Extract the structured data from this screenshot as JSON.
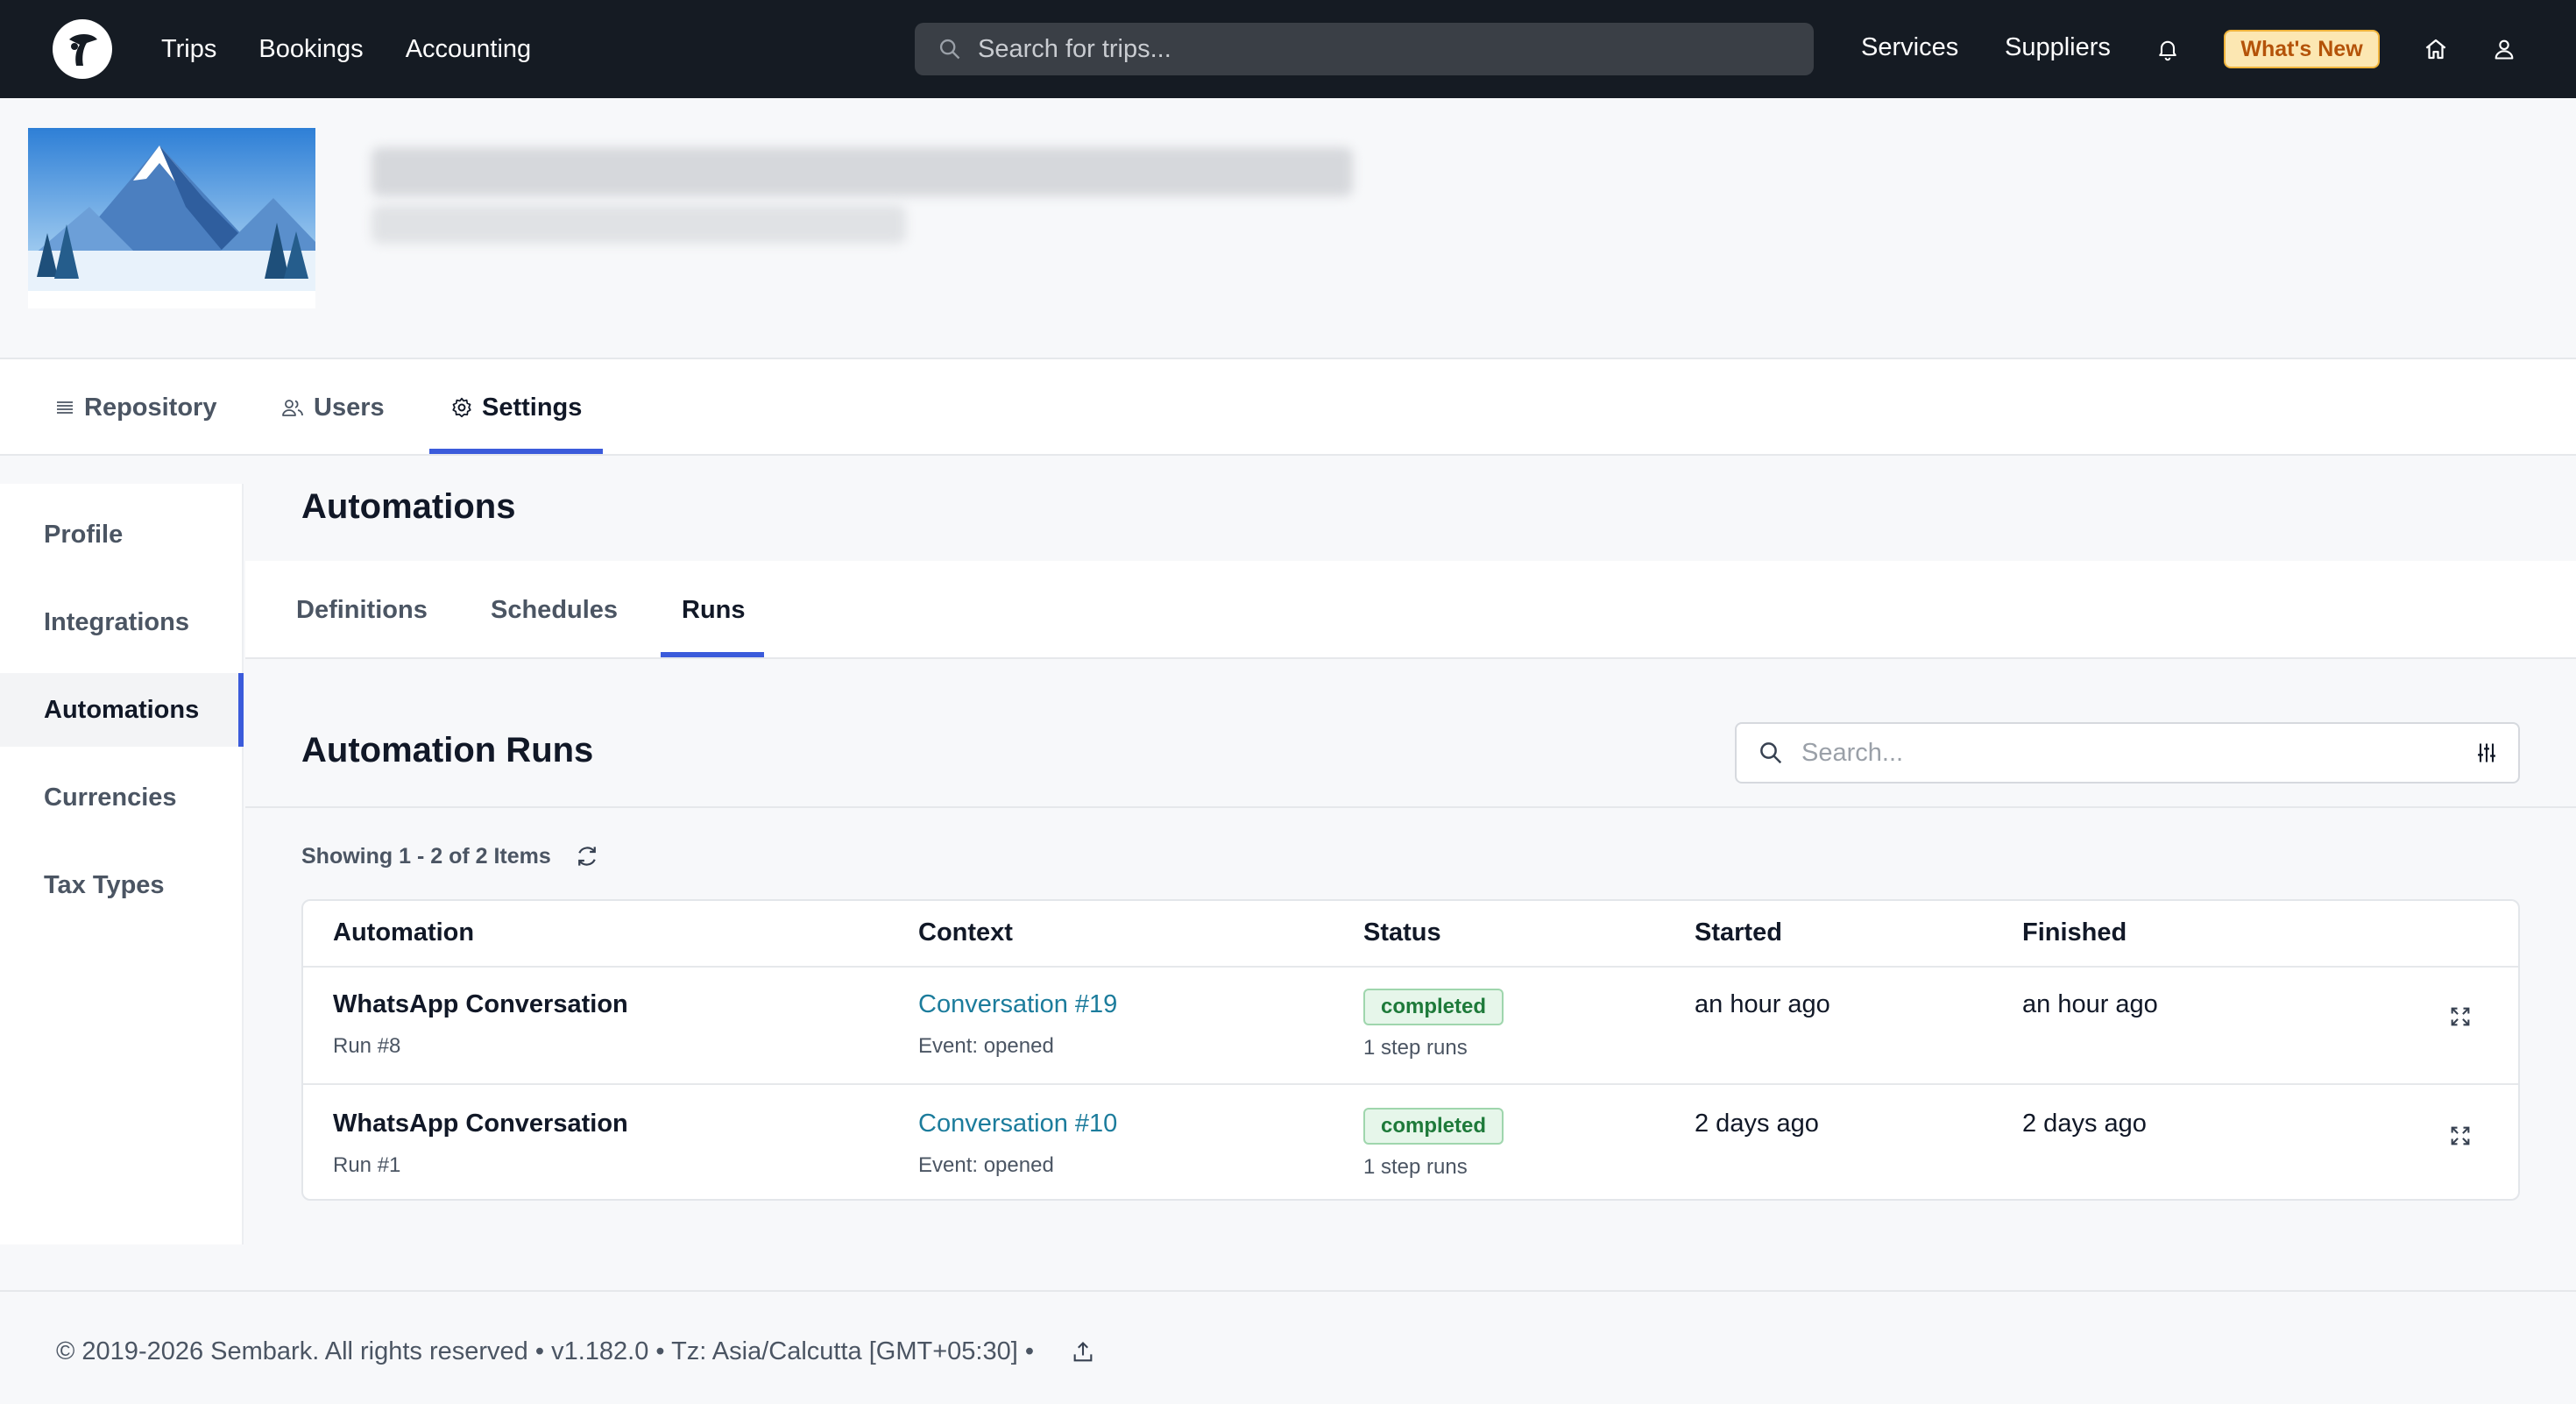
{
  "topnav": {
    "links": [
      "Trips",
      "Bookings",
      "Accounting"
    ],
    "search_placeholder": "Search for trips...",
    "right_links": [
      "Services",
      "Suppliers"
    ],
    "whats_new": "What's New"
  },
  "tabs": {
    "repository": "Repository",
    "users": "Users",
    "settings": "Settings"
  },
  "sidebar": {
    "items": [
      "Profile",
      "Integrations",
      "Automations",
      "Currencies",
      "Tax Types"
    ]
  },
  "page": {
    "title": "Automations",
    "subtabs": [
      "Definitions",
      "Schedules",
      "Runs"
    ],
    "runs_title": "Automation Runs",
    "search_placeholder": "Search...",
    "showing": "Showing 1 - 2 of 2 Items"
  },
  "table": {
    "headers": [
      "Automation",
      "Context",
      "Status",
      "Started",
      "Finished"
    ],
    "rows": [
      {
        "automation": "WhatsApp Conversation",
        "run": "Run #8",
        "context": "Conversation #19",
        "event": "Event: opened",
        "status": "completed",
        "steps": "1 step runs",
        "started": "an hour ago",
        "finished": "an hour ago"
      },
      {
        "automation": "WhatsApp Conversation",
        "run": "Run #1",
        "context": "Conversation #10",
        "event": "Event: opened",
        "status": "completed",
        "steps": "1 step runs",
        "started": "2 days ago",
        "finished": "2 days ago"
      }
    ]
  },
  "footer": {
    "text": "© 2019-2026 Sembark. All rights reserved • v1.182.0 • Tz: Asia/Calcutta [GMT+05:30] •"
  },
  "colors": {
    "nav_bg": "#151b23",
    "accent": "#3b5bdb",
    "link": "#1c7c9c",
    "status_green": "#1e7a3a"
  }
}
